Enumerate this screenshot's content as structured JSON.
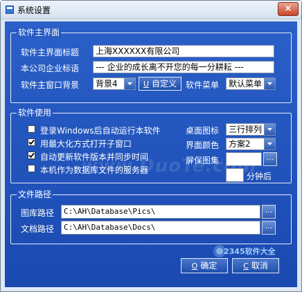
{
  "window": {
    "title": "系统设置",
    "close_glyph": "×"
  },
  "main_ui": {
    "group_title": "软件主界面",
    "title_label": "软件主界面标题",
    "title_value": "上海XXXXXX有限公司",
    "slogan_label": "本公司企业标语",
    "slogan_value": "--- 企业的成长离不开您的每一分耕耘 ---",
    "bg_label": "软件主窗口背景",
    "bg_value": "背景4",
    "custom_button_key": "U",
    "custom_button_label": "自定义",
    "menu_label": "软件菜单",
    "menu_value": "默认菜单"
  },
  "usage": {
    "group_title": "软件使用",
    "options": [
      {
        "label": "登录Windows后自动运行本软件",
        "checked": false
      },
      {
        "label": "用最大化方式打开子窗口",
        "checked": true
      },
      {
        "label": "自动更新软件版本并同步时间",
        "checked": true
      },
      {
        "label": "本机作为数据库文件的服务器",
        "checked": false
      }
    ],
    "desktop_icon_label": "桌面图标",
    "desktop_icon_value": "三行排列",
    "ui_color_label": "界面颜色",
    "ui_color_value": "方案2",
    "screensaver_label": "屏保图集",
    "minutes_label": "分钟后"
  },
  "paths": {
    "group_title": "文件路径",
    "gallery_label": "图库路径",
    "gallery_value": "C:\\AH\\Database\\Pics\\",
    "docs_label": "文档路径",
    "docs_value": "C:\\AH\\Database\\Docs\\",
    "browse_glyph": "..."
  },
  "buttons": {
    "ok_key": "O",
    "ok_label": "确定",
    "cancel_key": "C",
    "cancel_label": "取消"
  },
  "watermark": {
    "text": "www.DuoTe.com",
    "logo_text": "2345软件大全"
  },
  "colors": {
    "client_bg": "#1f52bb",
    "text": "#ffffff",
    "close": "#c8452a"
  }
}
